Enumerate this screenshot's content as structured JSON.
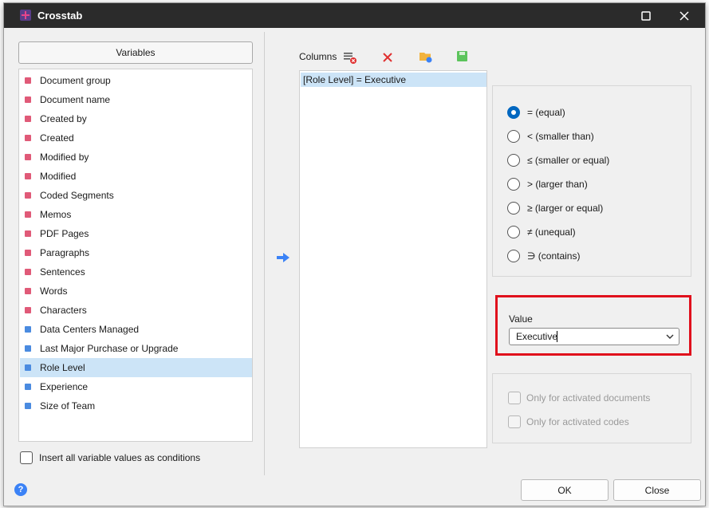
{
  "dialog": {
    "title": "Crosstab",
    "accent": "#0067c0",
    "highlight_border": "#e0101c"
  },
  "variables": {
    "button_label": "Variables",
    "items": [
      {
        "label": "Document group",
        "color": "#e05a78"
      },
      {
        "label": "Document name",
        "color": "#e05a78"
      },
      {
        "label": "Created by",
        "color": "#e05a78"
      },
      {
        "label": "Created",
        "color": "#e05a78"
      },
      {
        "label": "Modified by",
        "color": "#e05a78"
      },
      {
        "label": "Modified",
        "color": "#e05a78"
      },
      {
        "label": "Coded Segments",
        "color": "#e05a78"
      },
      {
        "label": "Memos",
        "color": "#e05a78"
      },
      {
        "label": "PDF Pages",
        "color": "#e05a78"
      },
      {
        "label": "Paragraphs",
        "color": "#e05a78"
      },
      {
        "label": "Sentences",
        "color": "#e05a78"
      },
      {
        "label": "Words",
        "color": "#e05a78"
      },
      {
        "label": "Characters",
        "color": "#e05a78"
      },
      {
        "label": "Data Centers Managed",
        "color": "#4a8be0"
      },
      {
        "label": "Last Major Purchase or Upgrade",
        "color": "#4a8be0"
      },
      {
        "label": "Role Level",
        "color": "#4a8be0"
      },
      {
        "label": "Experience",
        "color": "#4a8be0"
      },
      {
        "label": "Size of Team",
        "color": "#4a8be0"
      }
    ],
    "selected_index": 15,
    "insert_all_label": "Insert all variable values as conditions"
  },
  "columns": {
    "label": "Columns",
    "toolbar_icons": [
      "clear-list-icon",
      "delete-icon",
      "open-folder-icon",
      "save-icon"
    ],
    "items": [
      "[Role Level] = Executive"
    ]
  },
  "operators": {
    "selected_index": 0,
    "options": [
      "= (equal)",
      "< (smaller than)",
      "≤ (smaller or equal)",
      "> (larger than)",
      "≥ (larger or equal)",
      "≠ (unequal)",
      "∋ (contains)"
    ]
  },
  "value": {
    "label": "Value",
    "current": "Executive"
  },
  "restrictions": {
    "only_documents": "Only for activated documents",
    "only_codes": "Only for activated codes"
  },
  "buttons": {
    "ok": "OK",
    "close": "Close"
  }
}
